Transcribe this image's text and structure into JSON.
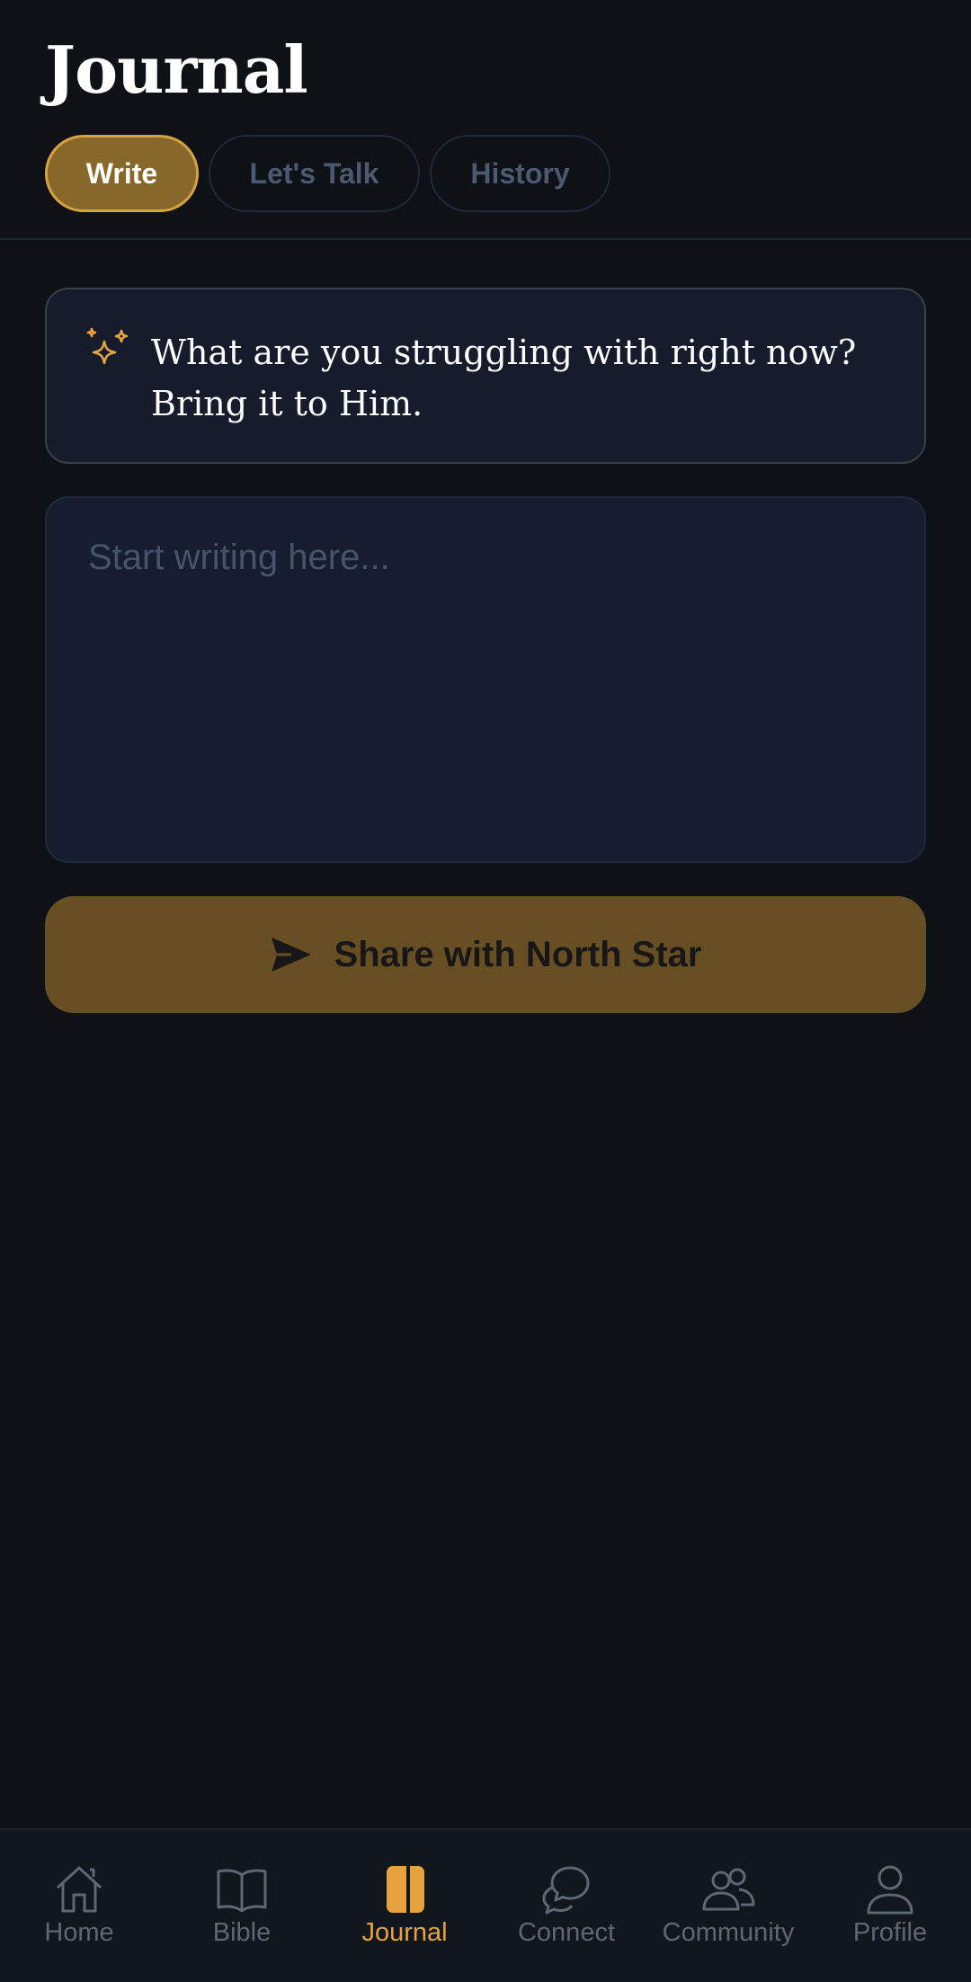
{
  "header": {
    "title": "Journal"
  },
  "tabs": [
    {
      "label": "Write",
      "active": true
    },
    {
      "label": "Let's Talk",
      "active": false
    },
    {
      "label": "History",
      "active": false
    }
  ],
  "prompt": {
    "icon": "sparkles-icon",
    "text": "What are you struggling with right now? Bring it to Him."
  },
  "editor": {
    "placeholder": "Start writing here...",
    "value": ""
  },
  "share": {
    "icon": "send-icon",
    "label": "Share with North Star"
  },
  "nav": {
    "items": [
      {
        "label": "Home",
        "icon": "home-icon",
        "active": false
      },
      {
        "label": "Bible",
        "icon": "book-open-icon",
        "active": false
      },
      {
        "label": "Journal",
        "icon": "journal-icon",
        "active": true
      },
      {
        "label": "Connect",
        "icon": "chat-bubbles-icon",
        "active": false
      },
      {
        "label": "Community",
        "icon": "users-icon",
        "active": false
      },
      {
        "label": "Profile",
        "icon": "user-icon",
        "active": false
      }
    ]
  },
  "colors": {
    "background": "#0e1116",
    "accent": "#e6a23c",
    "tab_active_bg": "#87682a",
    "card_bg": "#161c2b",
    "share_button_bg": "#674f23",
    "nav_inactive": "#5f6775"
  }
}
